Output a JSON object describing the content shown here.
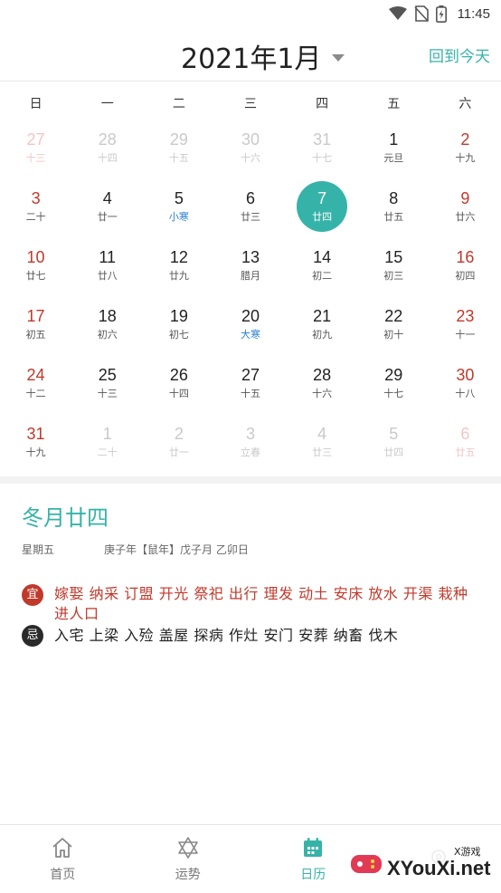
{
  "status_bar": {
    "time": "11:45"
  },
  "header": {
    "month_title": "2021年1月",
    "today_button": "回到今天"
  },
  "weekdays": [
    "日",
    "一",
    "二",
    "三",
    "四",
    "五",
    "六"
  ],
  "calendar": {
    "days": [
      {
        "d": "27",
        "l": "十三",
        "other": true,
        "weekend": true
      },
      {
        "d": "28",
        "l": "十四",
        "other": true
      },
      {
        "d": "29",
        "l": "十五",
        "other": true
      },
      {
        "d": "30",
        "l": "十六",
        "other": true
      },
      {
        "d": "31",
        "l": "十七",
        "other": true
      },
      {
        "d": "1",
        "l": "元旦",
        "festival": true
      },
      {
        "d": "2",
        "l": "十九",
        "weekend": true
      },
      {
        "d": "3",
        "l": "二十",
        "weekend": true
      },
      {
        "d": "4",
        "l": "廿一"
      },
      {
        "d": "5",
        "l": "小寒",
        "term": true
      },
      {
        "d": "6",
        "l": "廿三"
      },
      {
        "d": "7",
        "l": "廿四",
        "selected": true
      },
      {
        "d": "8",
        "l": "廿五"
      },
      {
        "d": "9",
        "l": "廿六",
        "weekend": true
      },
      {
        "d": "10",
        "l": "廿七",
        "weekend": true
      },
      {
        "d": "11",
        "l": "廿八"
      },
      {
        "d": "12",
        "l": "廿九"
      },
      {
        "d": "13",
        "l": "腊月"
      },
      {
        "d": "14",
        "l": "初二"
      },
      {
        "d": "15",
        "l": "初三"
      },
      {
        "d": "16",
        "l": "初四",
        "weekend": true
      },
      {
        "d": "17",
        "l": "初五",
        "weekend": true
      },
      {
        "d": "18",
        "l": "初六"
      },
      {
        "d": "19",
        "l": "初七"
      },
      {
        "d": "20",
        "l": "大寒",
        "term": true
      },
      {
        "d": "21",
        "l": "初九"
      },
      {
        "d": "22",
        "l": "初十"
      },
      {
        "d": "23",
        "l": "十一",
        "weekend": true
      },
      {
        "d": "24",
        "l": "十二",
        "weekend": true
      },
      {
        "d": "25",
        "l": "十三"
      },
      {
        "d": "26",
        "l": "十四"
      },
      {
        "d": "27",
        "l": "十五"
      },
      {
        "d": "28",
        "l": "十六"
      },
      {
        "d": "29",
        "l": "十七"
      },
      {
        "d": "30",
        "l": "十八",
        "weekend": true
      },
      {
        "d": "31",
        "l": "十九",
        "weekend": true
      },
      {
        "d": "1",
        "l": "二十",
        "other": true
      },
      {
        "d": "2",
        "l": "廿一",
        "other": true
      },
      {
        "d": "3",
        "l": "立春",
        "other": true
      },
      {
        "d": "4",
        "l": "廿三",
        "other": true
      },
      {
        "d": "5",
        "l": "廿四",
        "other": true
      },
      {
        "d": "6",
        "l": "廿五",
        "other": true,
        "weekend": true
      }
    ]
  },
  "detail": {
    "lunar_title": "冬月廿四",
    "weekday": "星期五",
    "ganzhi": "庚子年【鼠年】戊子月 乙卯日",
    "yi_badge": "宜",
    "yi_text": "嫁娶 纳采 订盟 开光 祭祀 出行 理发 动土 安床 放水 开渠 栽种 进人口",
    "ji_badge": "忌",
    "ji_text": "入宅 上梁 入殓 盖屋 探病 作灶 安门 安葬 纳畜 伐木"
  },
  "bottom_nav": {
    "home": "首页",
    "fortune": "运势",
    "calendar": "日历"
  },
  "watermark": {
    "sub": "X游戏",
    "main": "XYouXi.net"
  },
  "colors": {
    "accent": "#36b3a8",
    "weekend": "#c0392b",
    "term": "#2a7fd4"
  }
}
